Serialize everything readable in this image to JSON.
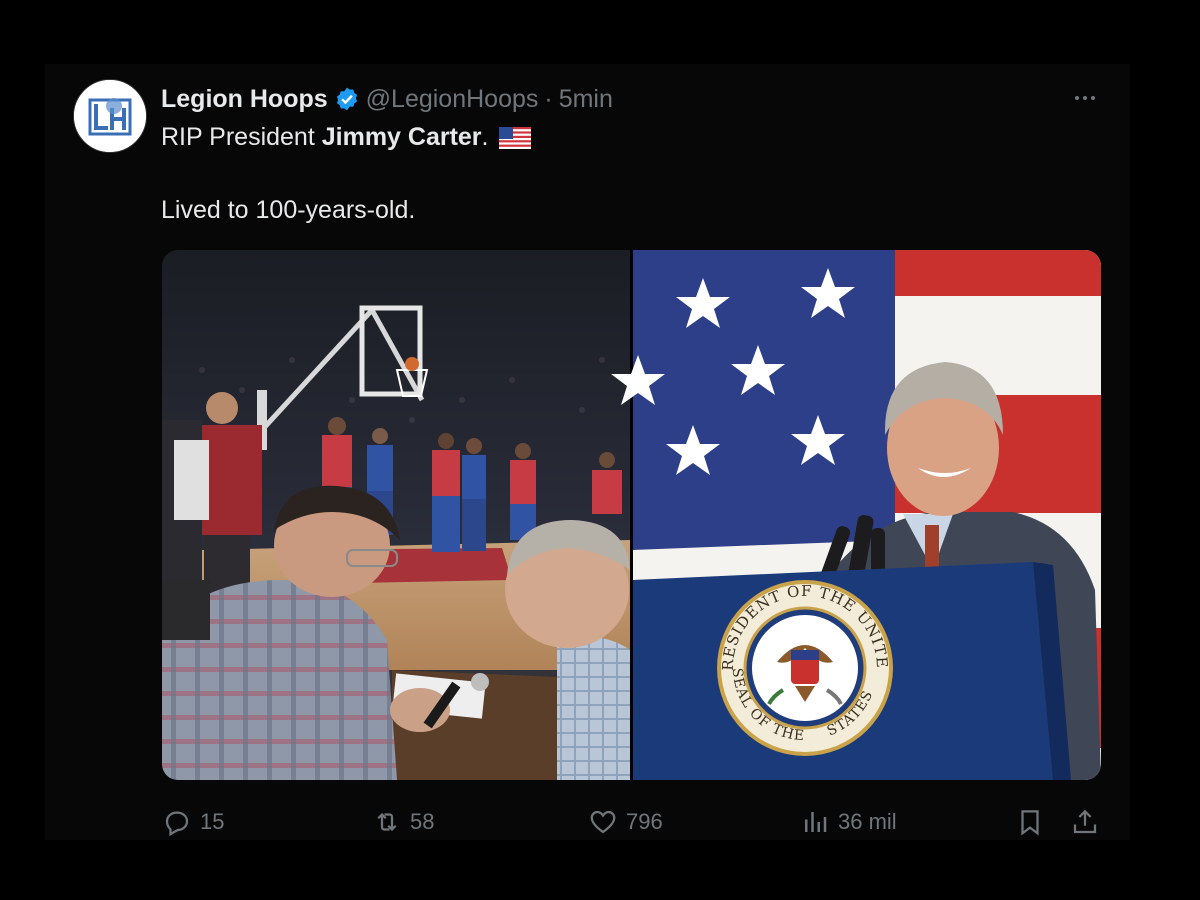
{
  "tweet": {
    "display_name": "Legion Hoops",
    "handle": "@LegionHoops",
    "separator": "·",
    "time": "5min",
    "text_prefix": "RIP President ",
    "text_bold": "Jimmy Carter",
    "text_suffix": ".",
    "text_line2": "Lived to 100-years-old."
  },
  "media": {
    "seal_top": "PRESIDENT OF THE UNITED",
    "seal_bottom": "SEAL OF THE",
    "seal_right": "STATES"
  },
  "actions": {
    "replies": "15",
    "reposts": "58",
    "likes": "796",
    "views": "36 mil"
  },
  "colors": {
    "background": "#000000",
    "text": "#e7e9ea",
    "muted": "#71767b",
    "verified": "#1d9bf0"
  },
  "icons": [
    "reply-icon",
    "repost-icon",
    "like-icon",
    "views-icon",
    "bookmark-icon",
    "share-icon",
    "verified-icon",
    "more-icon",
    "us-flag-emoji"
  ]
}
